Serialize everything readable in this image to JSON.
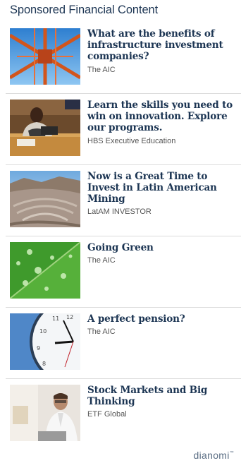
{
  "header": {
    "title": "Sponsored Financial Content"
  },
  "items": [
    {
      "title": "What are the benefits of infrastructure investment companies?",
      "source": "The AIC",
      "image": "bridge-image"
    },
    {
      "title": "Learn the skills you need to win on innovation. Explore our programs.",
      "source": "HBS Executive Education",
      "image": "speaker-image"
    },
    {
      "title": "Now is a Great Time to Invest in Latin American Mining",
      "source": "LatAM INVESTOR",
      "image": "mine-image"
    },
    {
      "title": "Going Green",
      "source": "The AIC",
      "image": "leaf-image"
    },
    {
      "title": "A perfect pension?",
      "source": "The AIC",
      "image": "clock-image"
    },
    {
      "title": "Stock Markets and Big Thinking",
      "source": "ETF Global",
      "image": "businessman-image"
    }
  ],
  "footer": {
    "logo": "dianomi"
  }
}
